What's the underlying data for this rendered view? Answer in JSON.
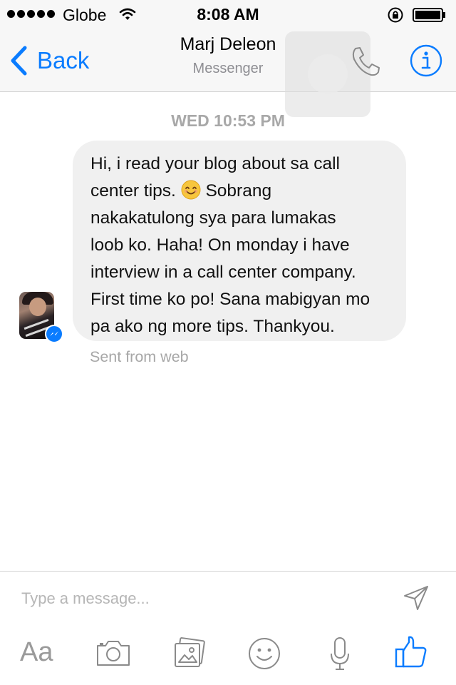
{
  "status_bar": {
    "carrier": "Globe",
    "time": "8:08 AM",
    "icons": [
      "signal-dots-icon",
      "wifi-icon",
      "orientation-lock-icon",
      "battery-icon"
    ]
  },
  "nav": {
    "back_label": "Back",
    "title": "Marj Deleon",
    "subtitle": "Messenger",
    "icons": [
      "chevron-left-icon",
      "phone-icon",
      "info-icon"
    ]
  },
  "conversation": {
    "timestamp": "WED 10:53 PM",
    "message": {
      "text_before_emoji": "Hi, i read your blog about sa call\ncenter tips. ",
      "emoji": "smiling-face-icon",
      "text_after_emoji": " Sobrang\nnakakatulong sya para lumakas\nloob ko. Haha! On monday i have\ninterview in a call center company.\nFirst time ko po! Sana mabigyan mo\npa ako ng more tips. Thankyou.",
      "meta": "Sent from web"
    }
  },
  "compose": {
    "placeholder": "Type a message...",
    "value": "",
    "send_icon": "send-icon"
  },
  "toolbar": {
    "text_label": "Aa",
    "icons": [
      "camera-icon",
      "gallery-icon",
      "emoji-icon",
      "microphone-icon",
      "like-icon"
    ]
  },
  "colors": {
    "accent": "#0a7cff",
    "bubble": "#f0f0f0",
    "muted": "#a8a8a8",
    "bar_background": "#f7f7f7"
  }
}
